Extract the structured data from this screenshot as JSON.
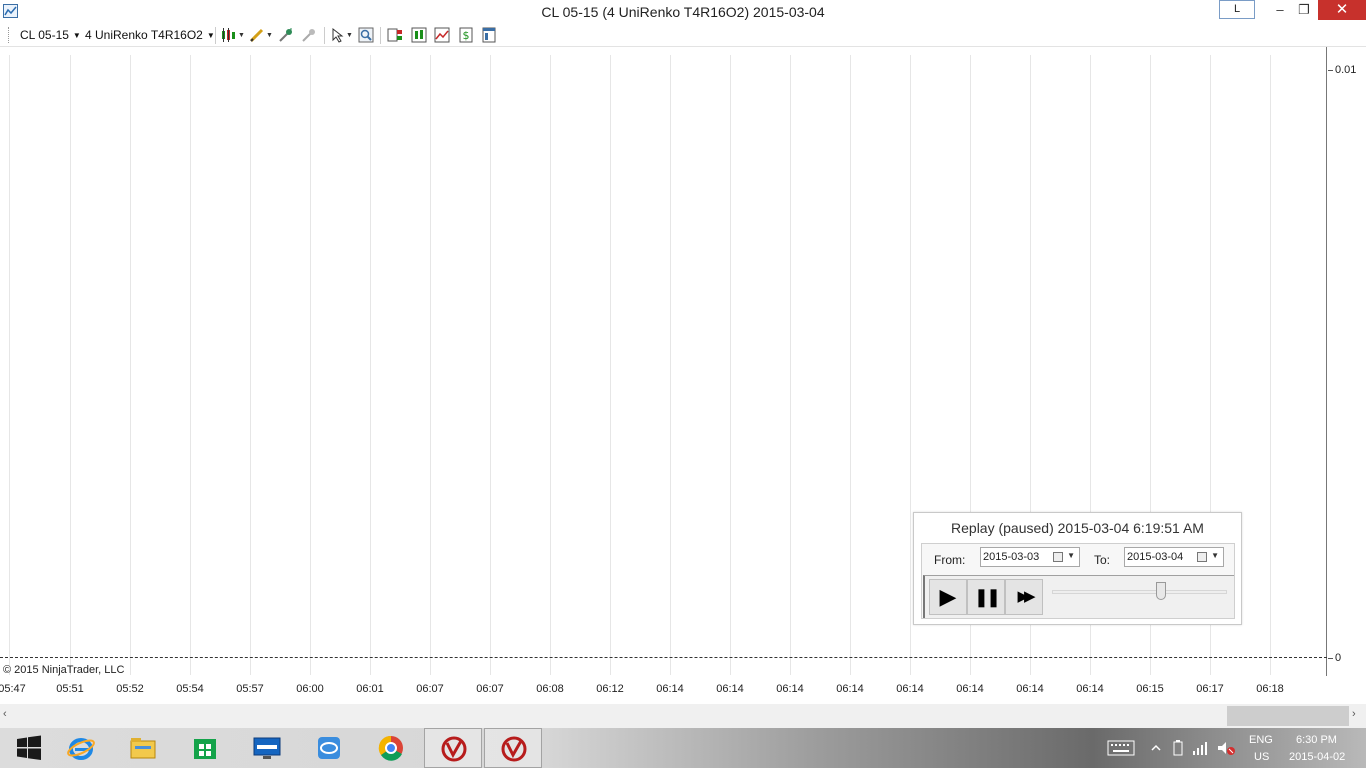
{
  "window": {
    "title": "CL 05-15 (4 UniRenko T4R16O2)  2015-03-04",
    "layout_button": "L",
    "minimize": "–",
    "maximize": "❐",
    "close": "✕"
  },
  "toolbar": {
    "instrument": "CL 05-15",
    "period": "4 UniRenko T4R16O2"
  },
  "chart": {
    "price_labels": [
      "0.01",
      "0"
    ],
    "copyright": "© 2015 NinjaTrader, LLC",
    "time_labels": [
      "05:47",
      "05:51",
      "05:52",
      "05:54",
      "05:57",
      "06:00",
      "06:01",
      "06:07",
      "06:07",
      "06:08",
      "06:12",
      "06:14",
      "06:14",
      "06:14",
      "06:14",
      "06:14",
      "06:14",
      "06:14",
      "06:14",
      "06:15",
      "06:17",
      "06:18"
    ]
  },
  "replay": {
    "status": "Replay (paused) 2015-03-04 6:19:51 AM",
    "from_label": "From:",
    "from_value": "2015-03-03",
    "to_label": "To:",
    "to_value": "2015-03-04",
    "play": "▶",
    "pause": "❚❚",
    "fast_forward": "▶▶",
    "speed_fraction": 0.62
  },
  "scrollbar": {
    "left_arrow": "‹",
    "right_arrow": "›"
  },
  "taskbar": {
    "lang_top": "ENG",
    "lang_bottom": "US",
    "time": "6:30 PM",
    "date": "2015-04-02"
  }
}
